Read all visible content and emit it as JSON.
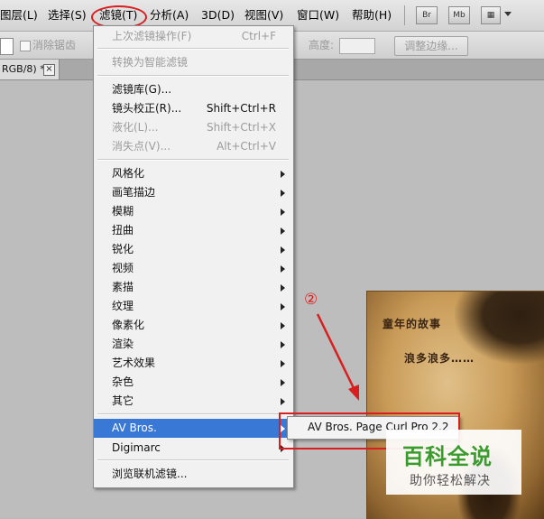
{
  "menubar": {
    "items": [
      "图层(L)",
      "选择(S)",
      "滤镜(T)",
      "分析(A)",
      "3D(D)",
      "视图(V)",
      "窗口(W)",
      "帮助(H)"
    ],
    "icons": [
      "Br",
      "Mb"
    ]
  },
  "options": {
    "antialias_label": "消除锯齿",
    "height_label": "高度:",
    "refine_edge_label": "调整边缘..."
  },
  "tab": {
    "label": "RGB/8) *",
    "close": "×"
  },
  "filter_menu": {
    "last_filter": {
      "label": "上次滤镜操作(F)",
      "shortcut": "Ctrl+F"
    },
    "smart_filter": "转换为智能滤镜",
    "gallery": "滤镜库(G)...",
    "lens": {
      "label": "镜头校正(R)...",
      "shortcut": "Shift+Ctrl+R"
    },
    "liquify": {
      "label": "液化(L)...",
      "shortcut": "Shift+Ctrl+X"
    },
    "vanish": {
      "label": "消失点(V)...",
      "shortcut": "Alt+Ctrl+V"
    },
    "groups": [
      "风格化",
      "画笔描边",
      "模糊",
      "扭曲",
      "锐化",
      "视频",
      "素描",
      "纹理",
      "像素化",
      "渲染",
      "艺术效果",
      "杂色",
      "其它"
    ],
    "plugins": [
      "AV Bros.",
      "Digimarc"
    ],
    "browse": "浏览联机滤镜..."
  },
  "submenu": {
    "item": "AV Bros. Page Curl Pro 2.2"
  },
  "annotation": {
    "number": "②",
    "color": "#d81e1e"
  },
  "photo": {
    "title": "童年的故事",
    "subtitle": "浪多浪多……"
  },
  "watermark": {
    "title": "百科全说",
    "subtitle": "助你轻松解决"
  },
  "colors": {
    "highlight": "#3a78d6",
    "annotation_red": "#d81e1e",
    "watermark_green": "#3b9b2e"
  }
}
